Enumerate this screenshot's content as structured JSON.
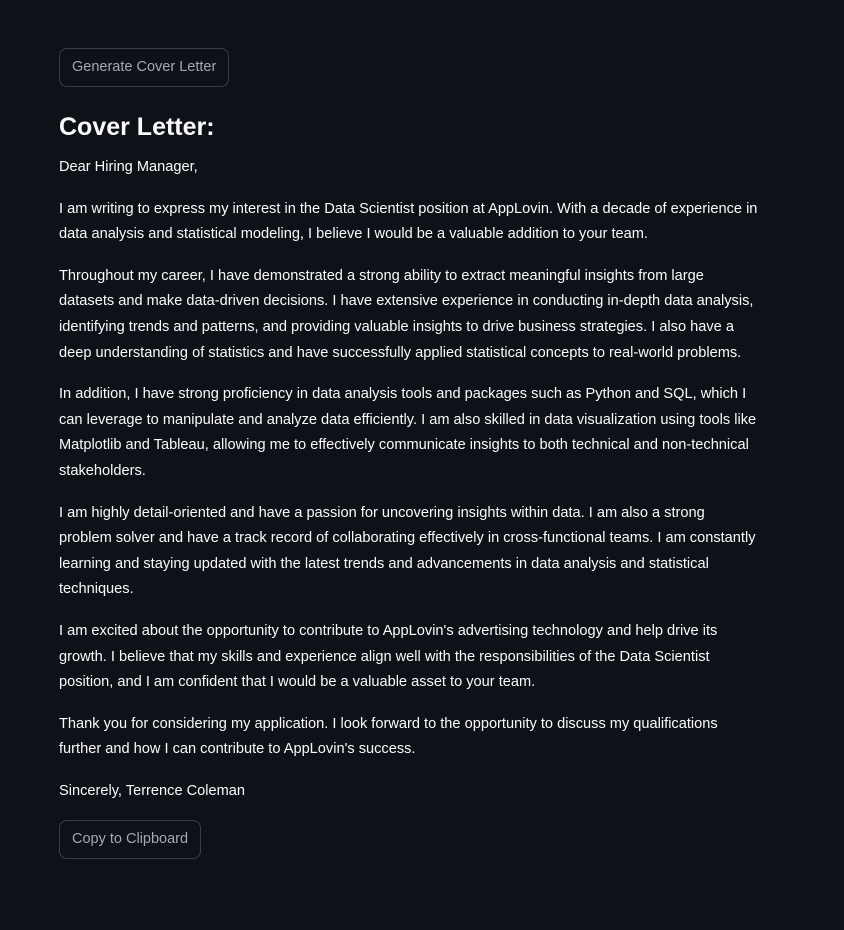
{
  "generate_button": {
    "label": "Generate Cover Letter"
  },
  "heading": "Cover Letter:",
  "letter": {
    "salutation": "Dear Hiring Manager,",
    "paragraphs": [
      "I am writing to express my interest in the Data Scientist position at AppLovin. With a decade of experience in data analysis and statistical modeling, I believe I would be a valuable addition to your team.",
      "Throughout my career, I have demonstrated a strong ability to extract meaningful insights from large datasets and make data-driven decisions. I have extensive experience in conducting in-depth data analysis, identifying trends and patterns, and providing valuable insights to drive business strategies. I also have a deep understanding of statistics and have successfully applied statistical concepts to real-world problems.",
      "In addition, I have strong proficiency in data analysis tools and packages such as Python and SQL, which I can leverage to manipulate and analyze data efficiently. I am also skilled in data visualization using tools like Matplotlib and Tableau, allowing me to effectively communicate insights to both technical and non-technical stakeholders.",
      "I am highly detail-oriented and have a passion for uncovering insights within data. I am also a strong problem solver and have a track record of collaborating effectively in cross-functional teams. I am constantly learning and staying updated with the latest trends and advancements in data analysis and statistical techniques.",
      "I am excited about the opportunity to contribute to AppLovin's advertising technology and help drive its growth. I believe that my skills and experience align well with the responsibilities of the Data Scientist position, and I am confident that I would be a valuable asset to your team.",
      "Thank you for considering my application. I look forward to the opportunity to discuss my qualifications further and how I can contribute to AppLovin's success."
    ],
    "closing": "Sincerely, Terrence Coleman"
  },
  "copy_button": {
    "label": "Copy to Clipboard"
  },
  "colors": {
    "background": "#0e1117",
    "text": "#fafafa",
    "button_text": "#a3a8b4",
    "button_border": "#3d3f47"
  }
}
